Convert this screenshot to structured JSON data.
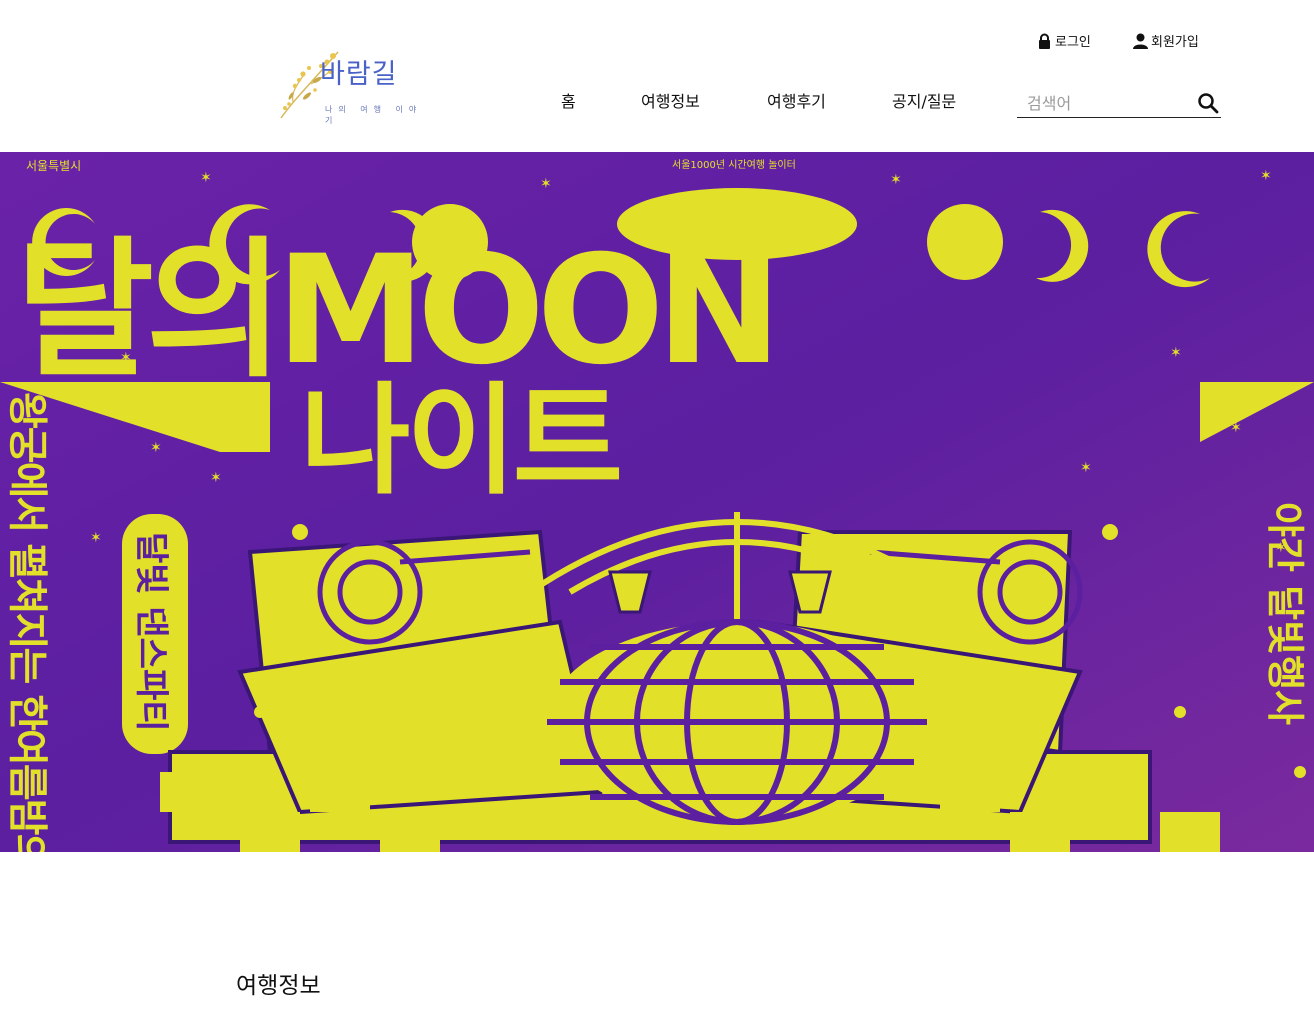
{
  "header": {
    "login_label": "로그인",
    "signup_label": "회원가입",
    "logo": {
      "title": "바람길",
      "subtitle": "나의 여행 이야기"
    },
    "nav": [
      {
        "label": "홈"
      },
      {
        "label": "여행정보"
      },
      {
        "label": "여행후기"
      },
      {
        "label": "공지/질문"
      }
    ],
    "search": {
      "placeholder": "검색어",
      "value": ""
    }
  },
  "banner": {
    "top_left_text": "서울특별시",
    "top_center_text": "서울1000년 시간여행 놀이터",
    "headline_line1": "달의MOON",
    "headline_line2": "나이트",
    "left_vertical_text": "왕궁에서 펼쳐지는 한여름밤의 파티",
    "side_badge_text": "달빛 댄스파티",
    "right_vertical_text": "야간 달빛행사",
    "colors": {
      "background": "#5b1fa0",
      "accent": "#e3e02a",
      "dark": "#3a1677"
    }
  },
  "main": {
    "section_title": "여행정보"
  }
}
